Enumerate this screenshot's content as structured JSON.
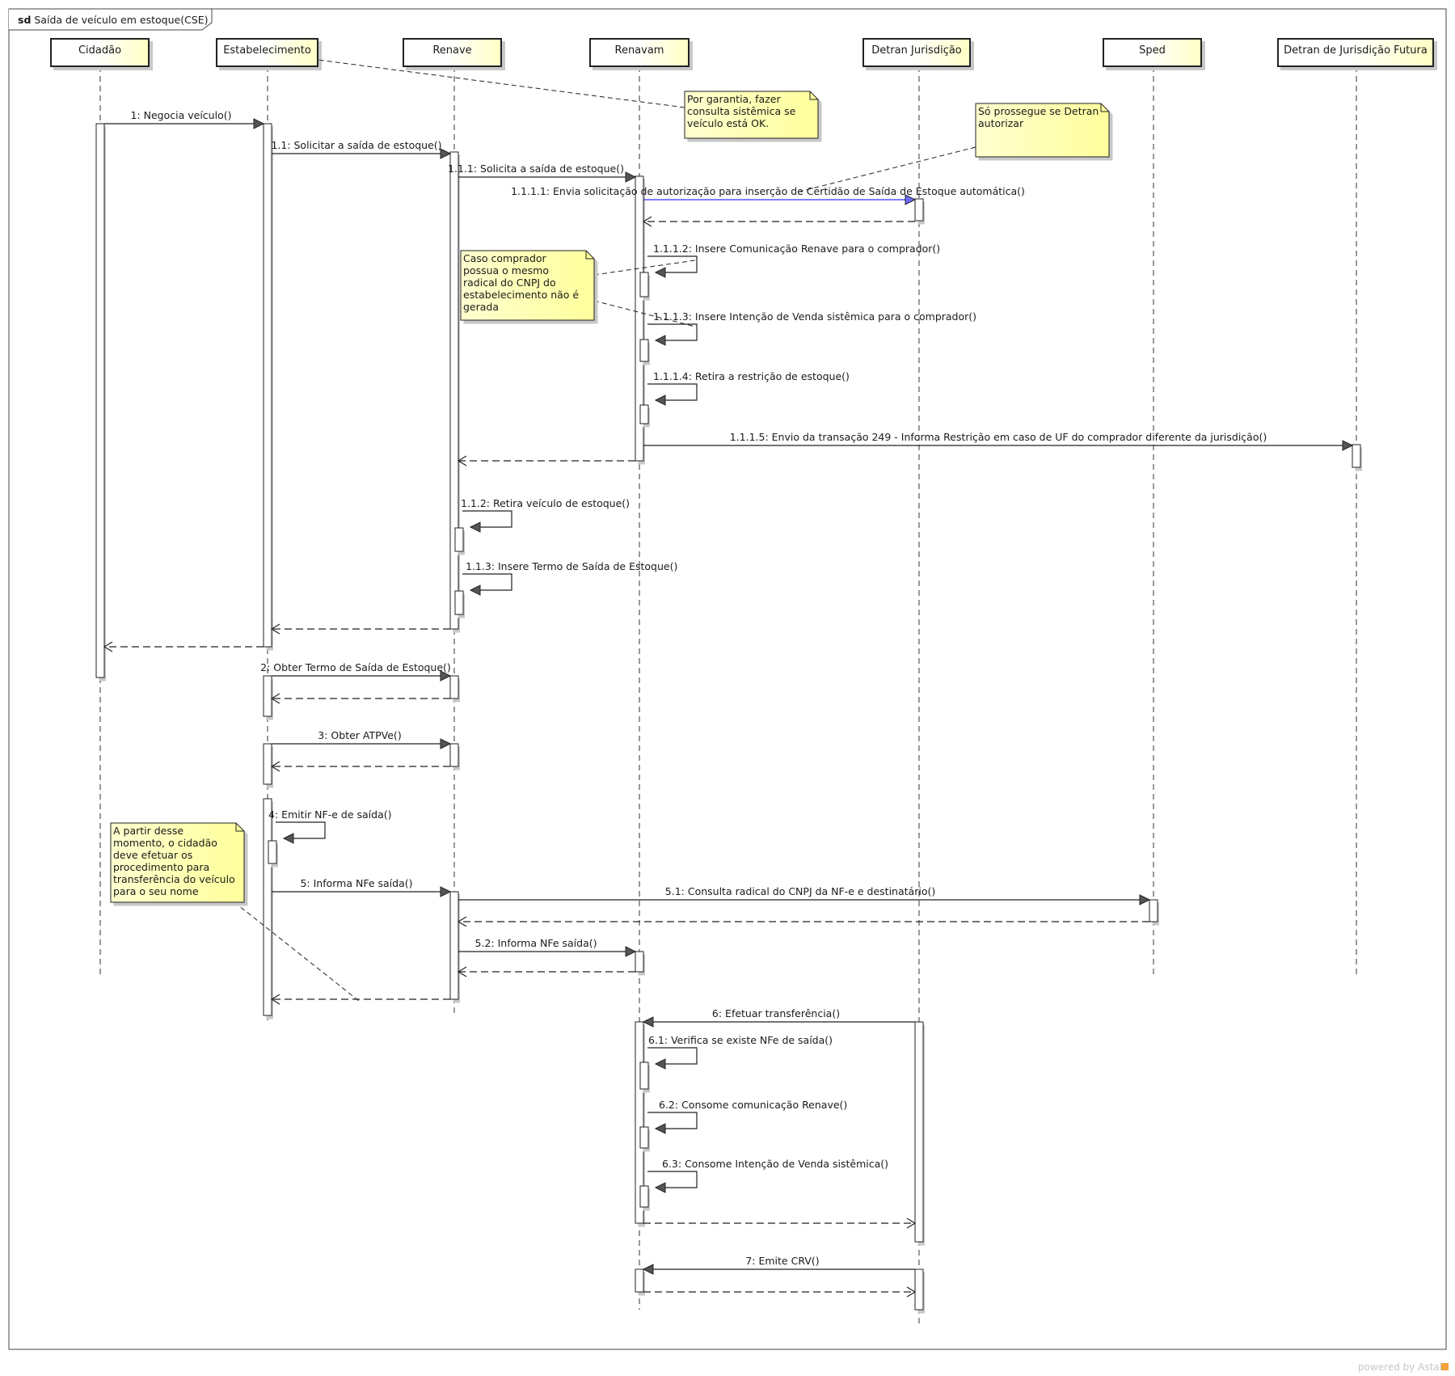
{
  "frame": {
    "keyword": "sd",
    "title": "Saída de veículo em estoque(CSE)"
  },
  "lifelines": [
    {
      "id": "cidadao",
      "label": "Cidadão"
    },
    {
      "id": "estab",
      "label": "Estabelecimento"
    },
    {
      "id": "renave",
      "label": "Renave"
    },
    {
      "id": "renavam",
      "label": "Renavam"
    },
    {
      "id": "detran",
      "label": "Detran Jurisdição"
    },
    {
      "id": "sped",
      "label": "Sped"
    },
    {
      "id": "futura",
      "label": "Detran de Jurisdição Futura"
    }
  ],
  "messages": [
    {
      "label": "1: Negocia veículo()"
    },
    {
      "label": "1.1: Solicitar a saída de estoque()"
    },
    {
      "label": "1.1.1: Solicita a saída de estoque()"
    },
    {
      "label": "1.1.1.1: Envia solicitação de autorização para inserção de Certidão de Saída de Estoque automática()"
    },
    {
      "label": ""
    },
    {
      "label": "1.1.1.2: Insere Comunicação Renave para o comprador()"
    },
    {
      "label": "1.1.1.3: Insere Intenção de Venda sistêmica para o comprador()"
    },
    {
      "label": "1.1.1.4: Retira a restrição de estoque()"
    },
    {
      "label": "1.1.1.5: Envio da transação 249 - Informa Restrição em caso de UF do comprador diferente da jurisdição()"
    },
    {
      "label": ""
    },
    {
      "label": "1.1.2: Retira veículo de estoque()"
    },
    {
      "label": "1.1.3: Insere Termo de Saída de Estoque()"
    },
    {
      "label": ""
    },
    {
      "label": ""
    },
    {
      "label": "2: Obter Termo de Saída de Estoque()"
    },
    {
      "label": ""
    },
    {
      "label": "3: Obter ATPVe()"
    },
    {
      "label": ""
    },
    {
      "label": "4: Emitir NF-e de saída()"
    },
    {
      "label": "5: Informa NFe saída()"
    },
    {
      "label": "5.1: Consulta radical do CNPJ da NF-e e destinatário()"
    },
    {
      "label": ""
    },
    {
      "label": "5.2: Informa NFe saída()"
    },
    {
      "label": ""
    },
    {
      "label": ""
    },
    {
      "label": "6: Efetuar transferência()"
    },
    {
      "label": "6.1: Verifica se existe NFe de saída()"
    },
    {
      "label": "6.2: Consome comunicação Renave()"
    },
    {
      "label": "6.3: Consome Intenção de Venda sistêmica()"
    },
    {
      "label": ""
    },
    {
      "label": "7: Emite CRV()"
    },
    {
      "label": ""
    }
  ],
  "notes": [
    {
      "lines": [
        "Por garantia, fazer",
        "consulta sistêmica se",
        "veículo está OK."
      ]
    },
    {
      "lines": [
        "Só prossegue se Detran",
        "autorizar"
      ]
    },
    {
      "lines": [
        "Caso comprador",
        "possua o mesmo",
        "radical do CNPJ do",
        "estabelecimento não é",
        "gerada"
      ]
    },
    {
      "lines": [
        "A partir desse",
        "momento, o cidadão",
        "deve efetuar os",
        "procedimento para",
        "transferência do veículo",
        "para o seu nome"
      ]
    }
  ],
  "credit": "powered by Astah",
  "colors": {
    "lifeline_fill": "#ffffd0",
    "note_fill": "#ffffc8",
    "highlight_arrow": "#3333ff",
    "line": "#333333"
  }
}
